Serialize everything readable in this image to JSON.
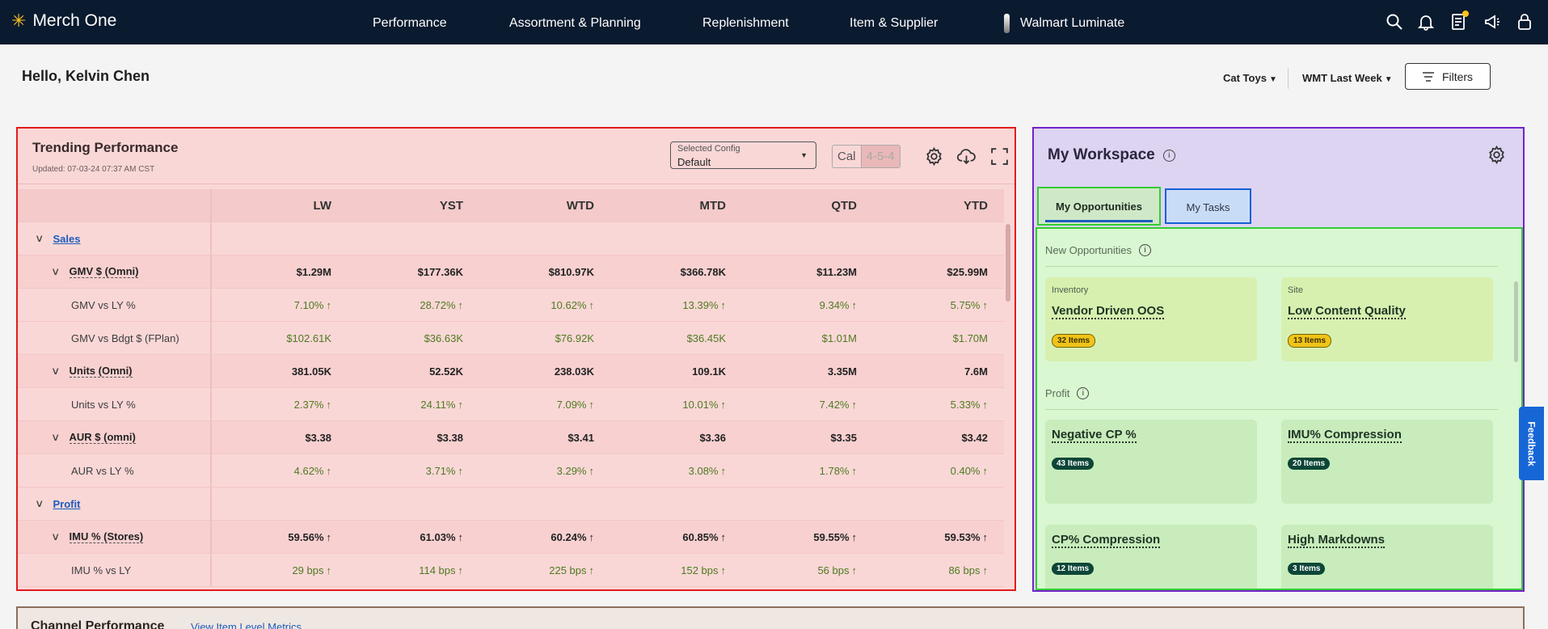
{
  "nav": {
    "brand": "Merch One",
    "links": [
      "Performance",
      "Assortment & Planning",
      "Replenishment",
      "Item & Supplier",
      "Walmart Luminate"
    ],
    "icons": [
      "search-icon",
      "bell-icon",
      "tasks-icon",
      "megaphone-icon",
      "user-icon"
    ],
    "accent": "#ffc220"
  },
  "header": {
    "greeting": "Hello, Kelvin Chen",
    "category": "Cat Toys",
    "period": "WMT Last Week",
    "filters": "Filters"
  },
  "trending": {
    "title": "Trending Performance",
    "updated": "Updated: 07-03-24 07:37 AM CST",
    "config_label": "Selected Config",
    "config_value": "Default",
    "cal_a": "Cal",
    "cal_b": "4-5-4",
    "columns": [
      "LW",
      "YST",
      "WTD",
      "MTD",
      "QTD",
      "YTD"
    ],
    "rows": [
      {
        "label": "Sales",
        "kind": "section",
        "values": []
      },
      {
        "label": "GMV $ (Omni)",
        "kind": "metric",
        "values": [
          "$1.29M",
          "$177.36K",
          "$810.97K",
          "$366.78K",
          "$11.23M",
          "$25.99M"
        ]
      },
      {
        "label": "GMV vs LY %",
        "kind": "sub",
        "values": [
          "7.10%",
          "28.72%",
          "10.62%",
          "13.39%",
          "9.34%",
          "5.75%"
        ],
        "arrow": true
      },
      {
        "label": "GMV vs Bdgt $ (FPlan)",
        "kind": "sub",
        "values": [
          "$102.61K",
          "$36.63K",
          "$76.92K",
          "$36.45K",
          "$1.01M",
          "$1.70M"
        ],
        "arrow": false
      },
      {
        "label": "Units (Omni)",
        "kind": "metric",
        "values": [
          "381.05K",
          "52.52K",
          "238.03K",
          "109.1K",
          "3.35M",
          "7.6M"
        ]
      },
      {
        "label": "Units vs LY %",
        "kind": "sub",
        "values": [
          "2.37%",
          "24.11%",
          "7.09%",
          "10.01%",
          "7.42%",
          "5.33%"
        ],
        "arrow": true
      },
      {
        "label": "AUR $ (omni)",
        "kind": "metric",
        "values": [
          "$3.38",
          "$3.38",
          "$3.41",
          "$3.36",
          "$3.35",
          "$3.42"
        ]
      },
      {
        "label": "AUR vs LY %",
        "kind": "sub",
        "values": [
          "4.62%",
          "3.71%",
          "3.29%",
          "3.08%",
          "1.78%",
          "0.40%"
        ],
        "arrow": true
      },
      {
        "label": "Profit",
        "kind": "section",
        "values": []
      },
      {
        "label": "IMU % (Stores)",
        "kind": "metric",
        "values": [
          "59.56%",
          "61.03%",
          "60.24%",
          "60.85%",
          "59.55%",
          "59.53%"
        ],
        "arrow": true
      },
      {
        "label": "IMU % vs LY",
        "kind": "sub",
        "values": [
          "29 bps",
          "114 bps",
          "225 bps",
          "152 bps",
          "56 bps",
          "86 bps"
        ],
        "arrow": true
      }
    ]
  },
  "workspace": {
    "title": "My Workspace",
    "tabs": [
      "My Opportunities",
      "My Tasks"
    ],
    "groups": {
      "new": "New Opportunities",
      "profit": "Profit"
    },
    "cards": [
      {
        "category": "Inventory",
        "name": "Vendor Driven OOS",
        "badge": "32 Items"
      },
      {
        "category": "Site",
        "name": "Low Content Quality",
        "badge": "13 Items"
      },
      {
        "category": "",
        "name": "Negative CP %",
        "badge": "43 Items"
      },
      {
        "category": "",
        "name": "IMU% Compression",
        "badge": "20 Items"
      },
      {
        "category": "",
        "name": "CP% Compression",
        "badge": "12 Items"
      },
      {
        "category": "",
        "name": "High Markdowns",
        "badge": "3 Items"
      }
    ]
  },
  "feedback": "Feedback",
  "channel": {
    "title": "Channel Performance",
    "link": "View Item Level Metrics"
  }
}
